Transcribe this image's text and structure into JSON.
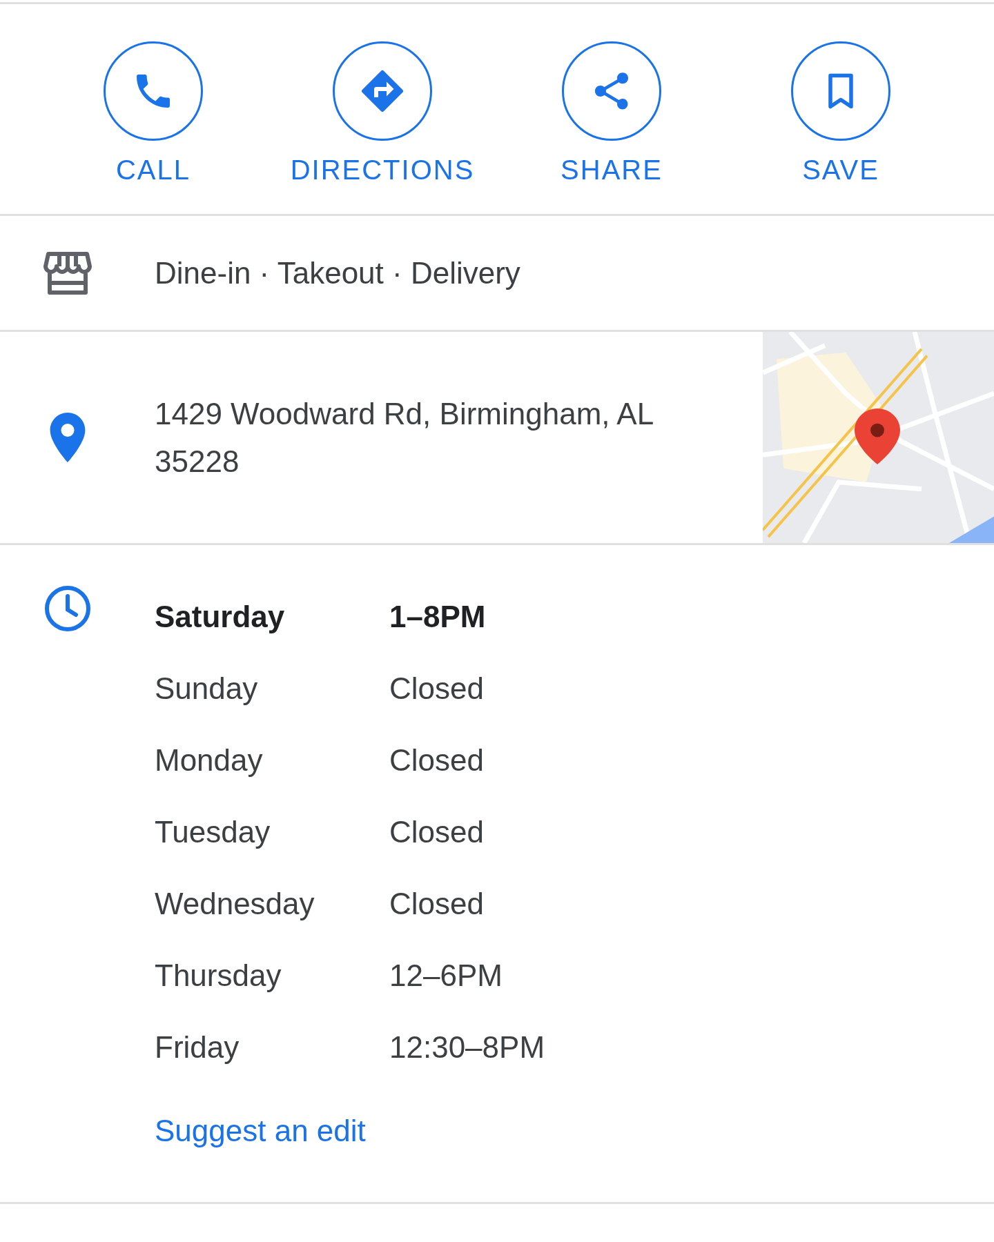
{
  "actions": [
    {
      "kind": "call",
      "label": "CALL"
    },
    {
      "kind": "directions",
      "label": "DIRECTIONS"
    },
    {
      "kind": "share",
      "label": "SHARE"
    },
    {
      "kind": "save",
      "label": "SAVE"
    }
  ],
  "service_options": "Dine-in · Takeout · Delivery",
  "address": {
    "text": "1429 Woodward Rd, Birmingham, AL 35228"
  },
  "hours": [
    {
      "day": "Saturday",
      "hours": "1–8PM",
      "selected": true
    },
    {
      "day": "Sunday",
      "hours": "Closed",
      "selected": false
    },
    {
      "day": "Monday",
      "hours": "Closed",
      "selected": false
    },
    {
      "day": "Tuesday",
      "hours": "Closed",
      "selected": false
    },
    {
      "day": "Wednesday",
      "hours": "Closed",
      "selected": false
    },
    {
      "day": "Thursday",
      "hours": "12–6PM",
      "selected": false
    },
    {
      "day": "Friday",
      "hours": "12:30–8PM",
      "selected": false
    }
  ],
  "suggest_edit": "Suggest an edit"
}
